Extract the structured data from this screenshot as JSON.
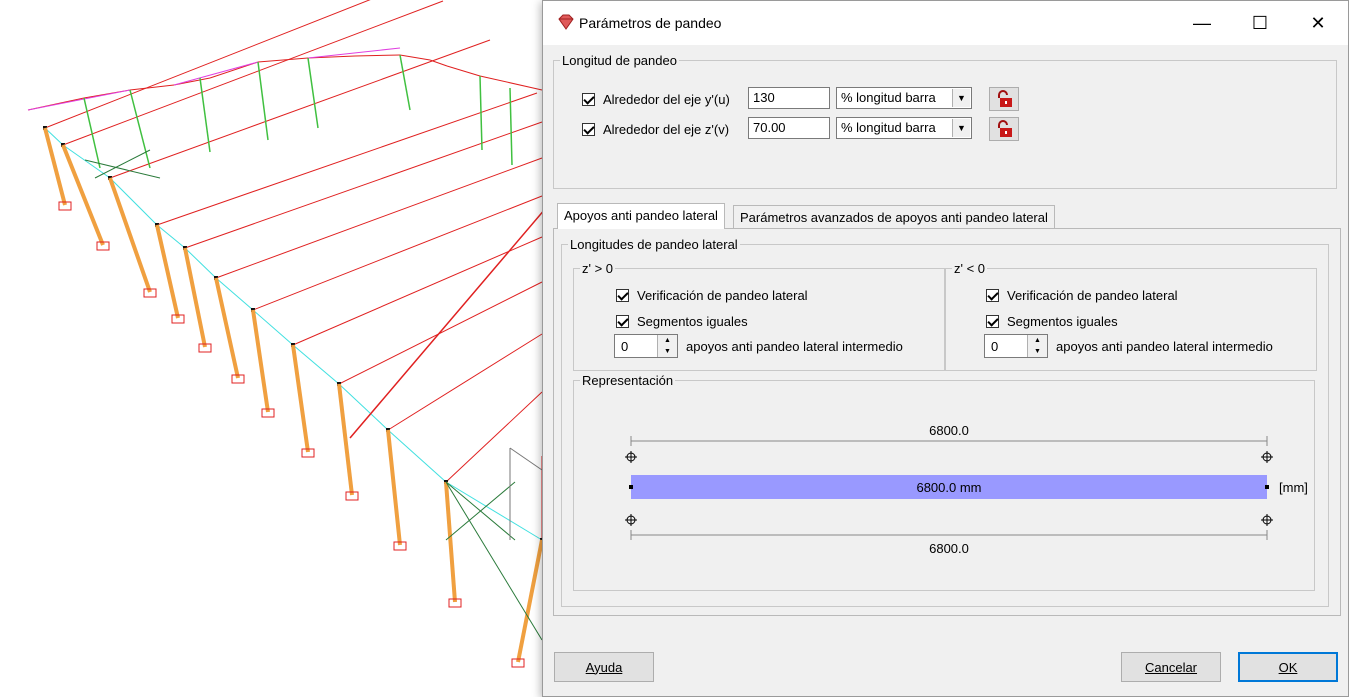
{
  "dialog": {
    "title": "Parámetros de pandeo"
  },
  "window_controls": {
    "minimize": "—",
    "maximize": "☐",
    "close": "✕"
  },
  "buckling_length": {
    "group_label": "Longitud de pandeo",
    "rows": [
      {
        "checked": true,
        "label": "Alrededor del eje y'(u)",
        "value": "130",
        "unit": "% longitud barra"
      },
      {
        "checked": true,
        "label": "Alrededor del eje z'(v)",
        "value": "70.00",
        "unit": "% longitud barra"
      }
    ]
  },
  "tabs": [
    {
      "label": "Apoyos anti pandeo lateral",
      "active": true
    },
    {
      "label": "Parámetros avanzados de apoyos anti pandeo lateral",
      "active": false
    }
  ],
  "lateral": {
    "group_label": "Longitudes de pandeo lateral",
    "zpos": {
      "label": "z' > 0",
      "verification_label": "Verificación de pandeo lateral",
      "verification_checked": true,
      "equal_segments_label": "Segmentos iguales",
      "equal_segments_checked": true,
      "supports_value": "0",
      "supports_label": "apoyos anti pandeo lateral intermedio"
    },
    "zneg": {
      "label": "z' < 0",
      "verification_label": "Verificación de pandeo lateral",
      "verification_checked": true,
      "equal_segments_label": "Segmentos iguales",
      "equal_segments_checked": true,
      "supports_value": "0",
      "supports_label": "apoyos anti pandeo lateral intermedio"
    }
  },
  "representation": {
    "group_label": "Representación",
    "top_dimension": "6800.0",
    "bar_label": "6800.0 mm",
    "bottom_dimension": "6800.0",
    "units": "[mm]",
    "bar_color": "#9999ff"
  },
  "buttons": {
    "help": "Ayuda",
    "cancel": "Cancelar",
    "ok": "OK"
  },
  "colors": {
    "beam_red": "#e02020",
    "column_orange": "#f0a040",
    "strut_green": "#40c040",
    "cyan_line": "#40e0e0",
    "magenta": "#e040e0"
  }
}
